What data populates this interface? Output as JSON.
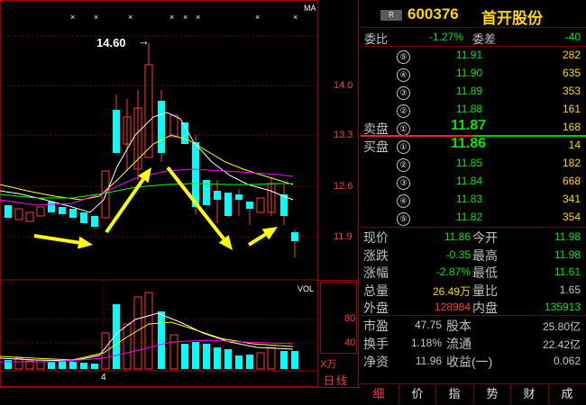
{
  "chart": {
    "ma_label": "MA",
    "vol_label": "VOL",
    "peak_label": "14.60",
    "peak_arrow": "→",
    "price_ticks": [
      "14.0",
      "13.3",
      "12.6",
      "11.9"
    ],
    "vol_ticks": [
      "80",
      "40"
    ],
    "x_unit": "X万",
    "day_label": "日线",
    "bottom_tick": "4",
    "marks": [
      "×",
      "×",
      "×",
      "×",
      "×",
      "×",
      "×",
      "×"
    ]
  },
  "quote": {
    "badge": "R",
    "code": "600376",
    "name": "首开股份",
    "ratio_label": "委比",
    "ratio_value": "-1.27%",
    "diff_label": "委差",
    "diff_value": "-40",
    "sell_label": "卖盘",
    "buy_label": "买盘",
    "sells": [
      {
        "level": "⑤",
        "price": "11.91",
        "vol": "282"
      },
      {
        "level": "④",
        "price": "11.90",
        "vol": "635"
      },
      {
        "level": "③",
        "price": "11.89",
        "vol": "353"
      },
      {
        "level": "②",
        "price": "11.88",
        "vol": "161"
      },
      {
        "level": "①",
        "price": "11.87",
        "vol": "168"
      }
    ],
    "buys": [
      {
        "level": "①",
        "price": "11.86",
        "vol": "14"
      },
      {
        "level": "②",
        "price": "11.85",
        "vol": "182"
      },
      {
        "level": "③",
        "price": "11.84",
        "vol": "668"
      },
      {
        "level": "④",
        "price": "11.83",
        "vol": "341"
      },
      {
        "level": "⑤",
        "price": "11.82",
        "vol": "354"
      }
    ],
    "stats": [
      {
        "l1": "现价",
        "v1": "11.86",
        "c1": "green",
        "l2": "今开",
        "v2": "11.98",
        "c2": "green"
      },
      {
        "l1": "涨跌",
        "v1": "-0.35",
        "c1": "green",
        "l2": "最高",
        "v2": "11.98",
        "c2": "green"
      },
      {
        "l1": "涨幅",
        "v1": "-2.87%",
        "c1": "green",
        "l2": "最低",
        "v2": "11.61",
        "c2": "green"
      },
      {
        "l1": "总量",
        "v1": "26.49万",
        "c1": "yellow",
        "l2": "量比",
        "v2": "1.65",
        "c2": "grey"
      },
      {
        "l1": "外盘",
        "v1": "128984",
        "c1": "red",
        "l2": "内盘",
        "v2": "135913",
        "c2": "green"
      }
    ],
    "fund": [
      {
        "l1": "市盈",
        "v1": "47.75",
        "l2": "股本",
        "v2": "25.80亿"
      },
      {
        "l1": "换手",
        "v1": "1.18%",
        "l2": "流通",
        "v2": "22.42亿"
      },
      {
        "l1": "净资",
        "v1": "11.96",
        "l2": "收益(一)",
        "v2": "0.062"
      }
    ],
    "tabs": [
      "细",
      "价",
      "指",
      "势",
      "财",
      "成"
    ]
  },
  "colors": {
    "up": "#ff3b3b",
    "down": "#00ffff",
    "grid": "#7a0000",
    "arrow": "#ffff00",
    "ma1": "#ffffff",
    "ma2": "#ffff00",
    "ma3": "#ff00ff",
    "ma4": "#00ff00"
  }
}
